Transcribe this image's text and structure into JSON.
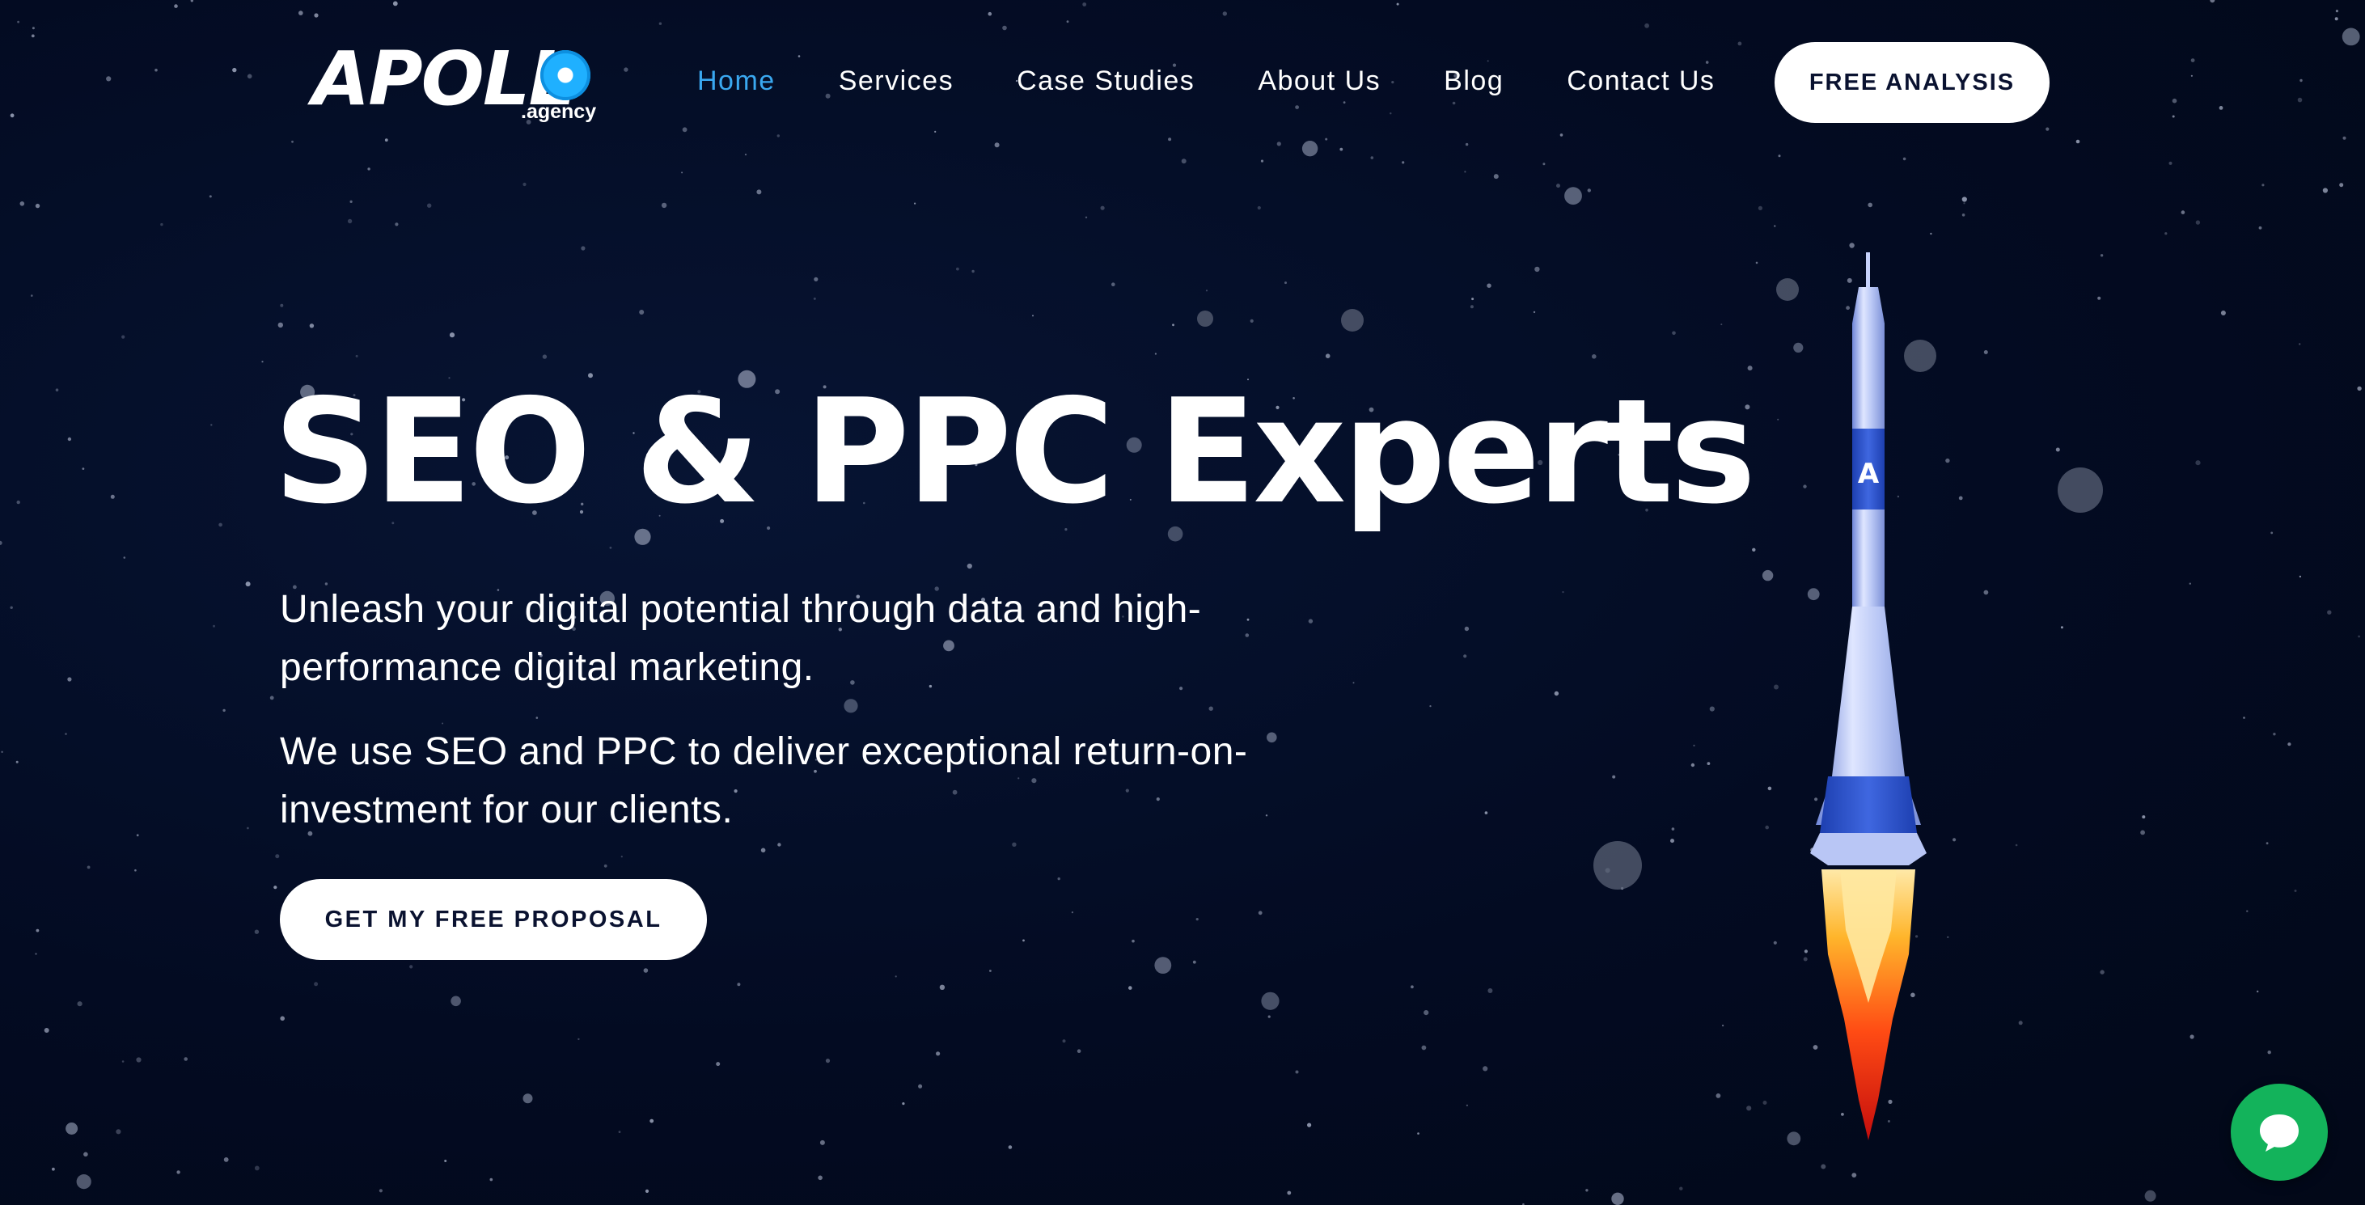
{
  "brand": {
    "logo_text": "APOLL",
    "logo_suffix": ".agency",
    "accent_color": "#3aa8f0"
  },
  "nav": {
    "items": [
      {
        "label": "Home",
        "active": true
      },
      {
        "label": "Services",
        "active": false
      },
      {
        "label": "Case Studies",
        "active": false
      },
      {
        "label": "About Us",
        "active": false
      },
      {
        "label": "Blog",
        "active": false
      },
      {
        "label": "Contact Us",
        "active": false
      }
    ],
    "cta_label": "FREE ANALYSIS"
  },
  "hero": {
    "title": "SEO & PPC Experts",
    "paragraph_1": "Unleash your digital potential through data and high-performance digital marketing.",
    "paragraph_2": "We use SEO and PPC to deliver exceptional return-on-investment for our clients.",
    "cta_label": "GET MY FREE PROPOSAL"
  },
  "illustration": {
    "icon": "rocket-icon",
    "badge_text": "A"
  },
  "chat": {
    "icon": "chat-bubble-icon",
    "color": "#13b35b"
  }
}
